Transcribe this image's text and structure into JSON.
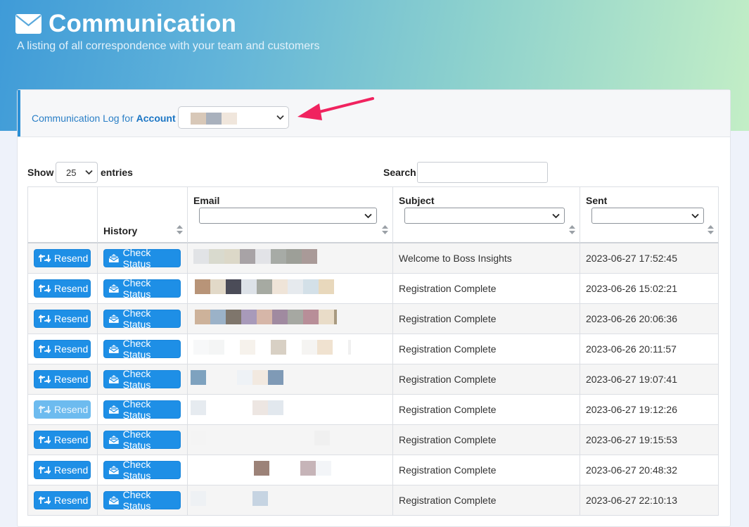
{
  "header": {
    "title": "Communication",
    "subtitle": "A listing of all correspondence with your team and customers",
    "icon": "envelope-icon"
  },
  "card": {
    "log_prefix": "Communication Log for ",
    "log_account": "Account",
    "accent_color": "#2a8fd6",
    "arrow_color": "#f0235f"
  },
  "controls": {
    "show_label": "Show",
    "entries_value": "25",
    "entries_label": "entries",
    "search_label": "Search:",
    "search_value": ""
  },
  "table": {
    "columns": [
      "",
      "History",
      "Email",
      "Subject",
      "Sent"
    ],
    "resend_label": "Resend",
    "check_status_label": "Check Status",
    "button_color": "#1e8fe6",
    "rows": [
      {
        "subject": "Welcome to Boss Insights",
        "sent": "2023-06-27 17:52:45",
        "resend_disabled": false
      },
      {
        "subject": "Registration Complete",
        "sent": "2023-06-26 15:02:21",
        "resend_disabled": false
      },
      {
        "subject": "Registration Complete",
        "sent": "2023-06-26 20:06:36",
        "resend_disabled": false
      },
      {
        "subject": "Registration Complete",
        "sent": "2023-06-26 20:11:57",
        "resend_disabled": false
      },
      {
        "subject": "Registration Complete",
        "sent": "2023-06-27 19:07:41",
        "resend_disabled": false
      },
      {
        "subject": "Registration Complete",
        "sent": "2023-06-27 19:12:26",
        "resend_disabled": true
      },
      {
        "subject": "Registration Complete",
        "sent": "2023-06-27 19:15:53",
        "resend_disabled": false
      },
      {
        "subject": "Registration Complete",
        "sent": "2023-06-27 20:48:32",
        "resend_disabled": false
      },
      {
        "subject": "Registration Complete",
        "sent": "2023-06-27 22:10:13",
        "resend_disabled": false
      }
    ]
  }
}
